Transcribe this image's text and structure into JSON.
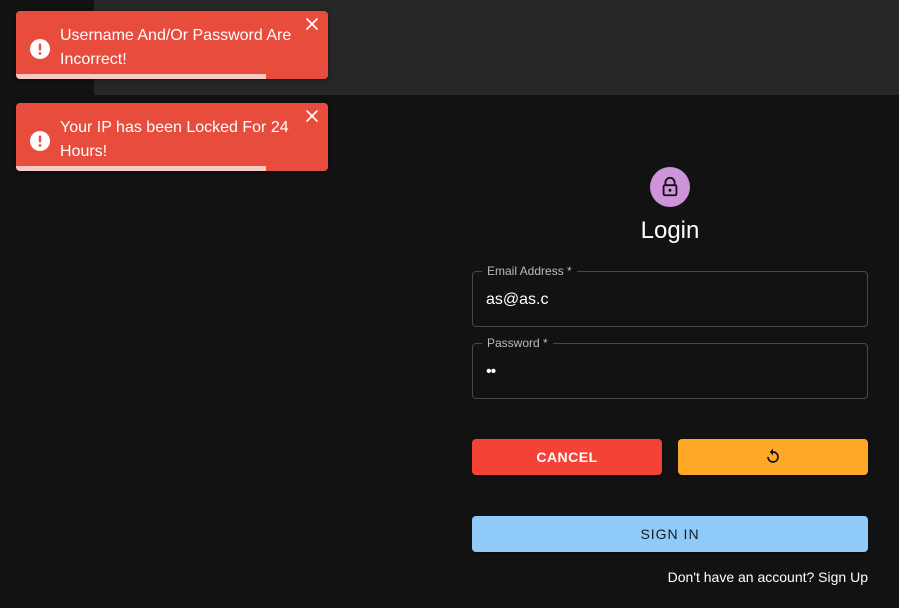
{
  "toasts": [
    {
      "message": "Username And/Or Password Are Incorrect!",
      "icon": "alert-circle-icon",
      "progress": 0.8
    },
    {
      "message": "Your IP has been Locked For 24 Hours!",
      "icon": "alert-circle-icon",
      "progress": 0.8
    }
  ],
  "colors": {
    "error": "#e74c3c",
    "cancel": "#f44336",
    "warning": "#ffa726",
    "primary": "#90caf9",
    "avatar": "#ce93d8",
    "background": "#121212",
    "appbar": "#272727"
  },
  "login": {
    "icon": "lock-icon",
    "title": "Login",
    "email": {
      "label": "Email Address *",
      "value": "as@as.c"
    },
    "password": {
      "label": "Password *",
      "value": "••"
    },
    "cancel_label": "CANCEL",
    "refresh_icon": "refresh-icon",
    "signin_label": "SIGN IN",
    "signup_text": "Don't have an account? Sign Up"
  }
}
